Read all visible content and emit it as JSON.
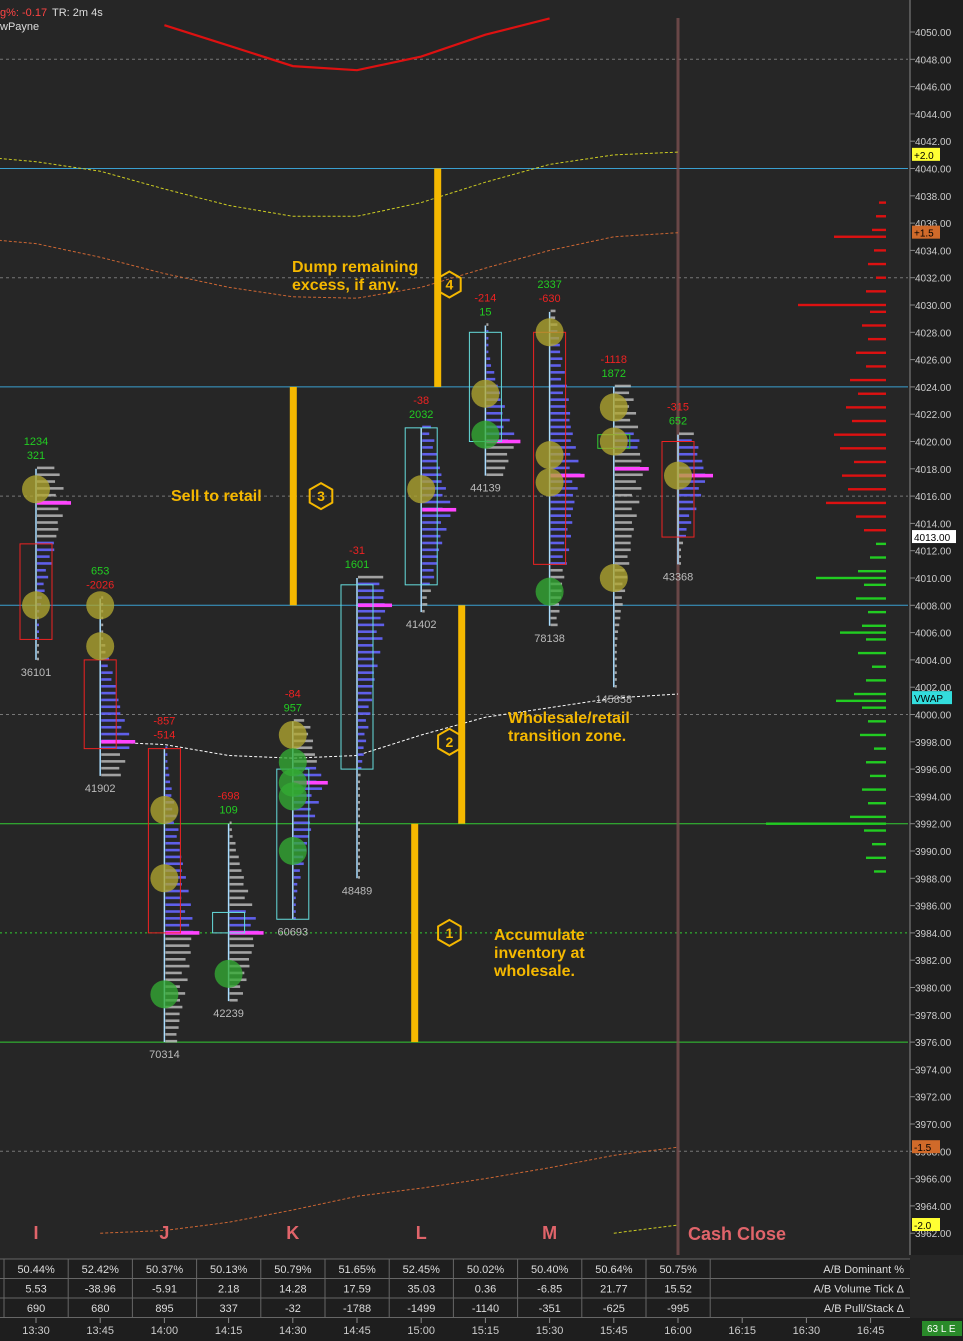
{
  "header": {
    "line1_a": "g%:",
    "line1_b": "-0.17",
    "line1_c": "TR: 2m 4s",
    "line2": "wPayne"
  },
  "colors": {
    "background": "#262626",
    "grid": "#555555",
    "price_axis_bg": "#1e1e1e",
    "annotation": "#f5b800",
    "buy_bar": "#6666ff",
    "sell_bar": "#cccccc",
    "poc": "#ff44ff",
    "delta_pos": "#22cc22",
    "delta_neg": "#ee2222",
    "vwap": "#ffffff",
    "blue_line": "#3a9fd0",
    "green_line": "#33cc33",
    "cash_close": "#e0646a"
  },
  "chart_data": {
    "type": "volume-profile",
    "y_axis": {
      "min": 3962,
      "max": 4051,
      "tick_step": 2,
      "side": "right"
    },
    "price_axis_labels": {
      "current": "4013.00",
      "vwap": "VWAP",
      "band_plus_2": "+2.0",
      "band_plus_1_5": "+1.5",
      "band_minus_1_5": "-1.5",
      "band_minus_2": "-2.0"
    },
    "x_axis": {
      "times": [
        "13:30",
        "13:45",
        "14:00",
        "14:15",
        "14:30",
        "14:45",
        "15:00",
        "15:15",
        "15:30",
        "15:45",
        "16:00",
        "16:15",
        "16:30",
        "16:45"
      ]
    },
    "period_letters": [
      {
        "letter": "I",
        "time": "13:30"
      },
      {
        "letter": "J",
        "time": "14:00"
      },
      {
        "letter": "K",
        "time": "14:30"
      },
      {
        "letter": "L",
        "time": "15:00"
      },
      {
        "letter": "M",
        "time": "15:30"
      }
    ],
    "cash_close": {
      "label": "Cash Close",
      "time": "16:00"
    },
    "horizontal_levels": [
      {
        "price": 4040.0,
        "color": "#3a9fd0",
        "style": "solid"
      },
      {
        "price": 4024.0,
        "color": "#3a9fd0",
        "style": "solid"
      },
      {
        "price": 4008.0,
        "color": "#3a9fd0",
        "style": "solid"
      },
      {
        "price": 3992.0,
        "color": "#33cc33",
        "style": "solid"
      },
      {
        "price": 3976.0,
        "color": "#33cc33",
        "style": "solid"
      },
      {
        "price": 3984.0,
        "color": "#33cc33",
        "style": "dotted"
      },
      {
        "price": 4048.0,
        "color": "#aaaaaa",
        "style": "dashed"
      },
      {
        "price": 4032.0,
        "color": "#aaaaaa",
        "style": "dashed"
      },
      {
        "price": 4016.0,
        "color": "#aaaaaa",
        "style": "dashed"
      },
      {
        "price": 4000.0,
        "color": "#aaaaaa",
        "style": "dashed"
      },
      {
        "price": 3968.0,
        "color": "#aaaaaa",
        "style": "dashed"
      }
    ],
    "profiles": [
      {
        "time": "13:30",
        "low": 4004.0,
        "high": 4018.0,
        "poc": 4015.5,
        "va_low": 4005.5,
        "va_high": 4012.5,
        "va_color": "#ee2222",
        "top_delta": "1234",
        "top_delta_color": "#22cc22",
        "second_delta": "321",
        "second_delta_color": "#22cc22",
        "volume": "36101",
        "circles": [
          {
            "price": 4016.5,
            "color": "yellow"
          },
          {
            "price": 4008.0,
            "color": "yellow"
          }
        ]
      },
      {
        "time": "13:45",
        "low": 3995.5,
        "high": 4008.5,
        "poc": 3998.0,
        "va_low": 3997.5,
        "va_high": 4004.0,
        "va_color": "#ee2222",
        "top_delta": "653",
        "top_delta_color": "#22cc22",
        "second_delta": "-2026",
        "second_delta_color": "#ee2222",
        "volume": "41902",
        "circles": [
          {
            "price": 4008.0,
            "color": "yellow"
          },
          {
            "price": 4005.0,
            "color": "yellow"
          }
        ]
      },
      {
        "time": "14:00",
        "low": 3976.0,
        "high": 3997.5,
        "poc": 3984.0,
        "va_low": 3984.0,
        "va_high": 3997.5,
        "va_color": "#ee2222",
        "top_delta": "-857",
        "top_delta_color": "#ee2222",
        "second_delta": "-514",
        "second_delta_color": "#ee2222",
        "volume": "70314",
        "circles": [
          {
            "price": 3993.0,
            "color": "yellow"
          },
          {
            "price": 3988.0,
            "color": "yellow"
          },
          {
            "price": 3979.5,
            "color": "green"
          }
        ]
      },
      {
        "time": "14:15",
        "low": 3979.0,
        "high": 3992.0,
        "poc": 3984.0,
        "va_low": 3984.0,
        "va_high": 3985.5,
        "va_color": "#66dddd",
        "top_delta": "-698",
        "top_delta_color": "#ee2222",
        "second_delta": "109",
        "second_delta_color": "#22cc22",
        "volume": "42239",
        "circles": [
          {
            "price": 3981.0,
            "color": "green"
          }
        ]
      },
      {
        "time": "14:30",
        "low": 3985.0,
        "high": 3999.5,
        "poc": 3995.0,
        "va_low": 3985.0,
        "va_high": 3996.0,
        "va_color": "#66dddd",
        "top_delta": "-84",
        "top_delta_color": "#ee2222",
        "second_delta": "957",
        "second_delta_color": "#22cc22",
        "volume": "60693",
        "circles": [
          {
            "price": 3998.5,
            "color": "yellow"
          },
          {
            "price": 3996.5,
            "color": "green"
          },
          {
            "price": 3995.0,
            "color": "green"
          },
          {
            "price": 3994.0,
            "color": "green"
          },
          {
            "price": 3990.0,
            "color": "green"
          }
        ]
      },
      {
        "time": "14:45",
        "low": 3988.0,
        "high": 4010.0,
        "poc": 4008.0,
        "va_low": 3996.0,
        "va_high": 4009.5,
        "va_color": "#66dddd",
        "top_delta": "-31",
        "top_delta_color": "#ee2222",
        "second_delta": "1601",
        "second_delta_color": "#22cc22",
        "volume": "48489",
        "circles": []
      },
      {
        "time": "15:00",
        "low": 4007.5,
        "high": 4021.0,
        "poc": 4015.0,
        "va_low": 4009.5,
        "va_high": 4021.0,
        "va_color": "#66dddd",
        "top_delta": "-38",
        "top_delta_color": "#ee2222",
        "second_delta": "2032",
        "second_delta_color": "#22cc22",
        "volume": "41402",
        "circles": [
          {
            "price": 4016.5,
            "color": "yellow"
          }
        ]
      },
      {
        "time": "15:15",
        "low": 4017.5,
        "high": 4028.5,
        "poc": 4020.0,
        "va_low": 4020.0,
        "va_high": 4028.0,
        "va_color": "#66dddd",
        "top_delta": "-214",
        "top_delta_color": "#ee2222",
        "second_delta": "15",
        "second_delta_color": "#22cc22",
        "volume": "44139",
        "circles": [
          {
            "price": 4023.5,
            "color": "yellow"
          },
          {
            "price": 4020.5,
            "color": "green"
          }
        ]
      },
      {
        "time": "15:30",
        "low": 4006.5,
        "high": 4029.5,
        "poc": 4017.5,
        "va_low": 4011.0,
        "va_high": 4028.0,
        "va_color": "#ee2222",
        "top_delta": "2337",
        "top_delta_color": "#22cc22",
        "second_delta": "-630",
        "second_delta_color": "#ee2222",
        "volume": "78138",
        "circles": [
          {
            "price": 4028.0,
            "color": "yellow"
          },
          {
            "price": 4019.0,
            "color": "yellow"
          },
          {
            "price": 4017.0,
            "color": "yellow"
          },
          {
            "price": 4009.0,
            "color": "green"
          }
        ]
      },
      {
        "time": "15:45",
        "low": 4002.0,
        "high": 4024.0,
        "poc": 4018.0,
        "va_low": 4019.5,
        "va_high": 4020.5,
        "va_color": "#33cc33",
        "top_delta": "-1118",
        "top_delta_color": "#ee2222",
        "second_delta": "1872",
        "second_delta_color": "#22cc22",
        "volume": "145858",
        "circles": [
          {
            "price": 4022.5,
            "color": "yellow"
          },
          {
            "price": 4020.0,
            "color": "yellow"
          },
          {
            "price": 4010.0,
            "color": "yellow"
          }
        ]
      },
      {
        "time": "16:00",
        "low": 4011.0,
        "high": 4020.5,
        "poc": 4017.5,
        "va_low": 4013.0,
        "va_high": 4020.0,
        "va_color": "#ee2222",
        "top_delta": "-315",
        "top_delta_color": "#ee2222",
        "second_delta": "652",
        "second_delta_color": "#22cc22",
        "volume": "43368",
        "circles": [
          {
            "price": 4017.5,
            "color": "yellow"
          }
        ]
      }
    ],
    "annotations": [
      {
        "number": "1",
        "text": [
          "Accumulate",
          "inventory at",
          "wholesale."
        ],
        "bar_time": "15:00",
        "bar_low": 3976,
        "bar_high": 3992,
        "badge_time": "15:15",
        "badge_price": 3984.0
      },
      {
        "number": "2",
        "text": [
          "Wholesale/retail",
          "transition zone."
        ],
        "bar_time": "15:00",
        "bar_low": 3992,
        "bar_high": 4008,
        "badge_time": "15:15",
        "badge_price": 3998.0
      },
      {
        "number": "3",
        "text": [
          "Sell to retail"
        ],
        "bar_time": "14:30",
        "bar_low": 4008,
        "bar_high": 4024,
        "badge_time": "14:45",
        "badge_price": 4016.0
      },
      {
        "number": "4",
        "text": [
          "Dump remaining",
          "excess, if any."
        ],
        "bar_time": "15:00",
        "bar_low": 4024,
        "bar_high": 4040,
        "badge_time": "15:15",
        "badge_price": 4031.5
      }
    ],
    "bands": {
      "vwap": [
        [
          13.75,
          3998.0
        ],
        [
          14.0,
          3997.8
        ],
        [
          14.25,
          3997.0
        ],
        [
          14.5,
          3996.8
        ],
        [
          14.75,
          3997.0
        ],
        [
          15.0,
          3998.5
        ],
        [
          15.25,
          3999.8
        ],
        [
          15.5,
          4000.5
        ],
        [
          15.75,
          4001.2
        ],
        [
          16.0,
          4001.5
        ]
      ],
      "upper_red": [
        [
          14.0,
          4050.5
        ],
        [
          14.25,
          4049.0
        ],
        [
          14.5,
          4047.5
        ],
        [
          14.75,
          4047.2
        ],
        [
          15.0,
          4048.2
        ],
        [
          15.25,
          4049.8
        ],
        [
          15.5,
          4051.0
        ]
      ],
      "upper_yellow": [
        [
          13.2,
          4041.0
        ],
        [
          13.5,
          4040.5
        ],
        [
          13.75,
          4039.8
        ],
        [
          14.0,
          4038.5
        ],
        [
          14.25,
          4037.3
        ],
        [
          14.5,
          4036.5
        ],
        [
          14.75,
          4036.5
        ],
        [
          15.0,
          4037.5
        ],
        [
          15.25,
          4039.0
        ],
        [
          15.5,
          4040.3
        ],
        [
          15.75,
          4041.0
        ],
        [
          16.0,
          4041.2
        ]
      ],
      "upper_orange": [
        [
          13.2,
          4035.0
        ],
        [
          13.5,
          4034.5
        ],
        [
          13.75,
          4033.5
        ],
        [
          14.0,
          4032.3
        ],
        [
          14.25,
          4031.3
        ],
        [
          14.5,
          4030.6
        ],
        [
          14.75,
          4030.5
        ],
        [
          15.0,
          4031.3
        ],
        [
          15.25,
          4032.7
        ],
        [
          15.5,
          4034.0
        ],
        [
          15.75,
          4035.0
        ],
        [
          16.0,
          4035.3
        ]
      ],
      "lower_orange": [
        [
          13.75,
          3962.0
        ],
        [
          14.0,
          3962.2
        ],
        [
          14.25,
          3962.8
        ],
        [
          14.5,
          3963.7
        ],
        [
          14.75,
          3964.7
        ],
        [
          15.0,
          3965.3
        ],
        [
          15.25,
          3966.0
        ],
        [
          15.5,
          3966.8
        ],
        [
          15.75,
          3967.7
        ],
        [
          16.0,
          3968.3
        ]
      ],
      "lower_yellow": [
        [
          15.75,
          3962.0
        ],
        [
          16.0,
          3962.6
        ]
      ]
    },
    "session_profile": {
      "sell": [
        [
          4037.5,
          7
        ],
        [
          4036.5,
          10
        ],
        [
          4035.5,
          14
        ],
        [
          4035.0,
          52
        ],
        [
          4034.0,
          12
        ],
        [
          4033.0,
          18
        ],
        [
          4032.0,
          10
        ],
        [
          4031.0,
          20
        ],
        [
          4030.0,
          88
        ],
        [
          4029.5,
          16
        ],
        [
          4028.5,
          24
        ],
        [
          4027.5,
          18
        ],
        [
          4026.5,
          30
        ],
        [
          4025.5,
          20
        ],
        [
          4024.5,
          36
        ],
        [
          4023.5,
          28
        ],
        [
          4022.5,
          40
        ],
        [
          4021.5,
          34
        ],
        [
          4020.5,
          52
        ],
        [
          4019.5,
          46
        ],
        [
          4018.5,
          32
        ],
        [
          4017.5,
          44
        ],
        [
          4016.5,
          38
        ],
        [
          4015.5,
          60
        ],
        [
          4014.5,
          30
        ],
        [
          4013.5,
          22
        ]
      ],
      "buy": [
        [
          4012.5,
          10
        ],
        [
          4011.5,
          16
        ],
        [
          4010.5,
          28
        ],
        [
          4010.0,
          70
        ],
        [
          4009.5,
          22
        ],
        [
          4008.5,
          30
        ],
        [
          4007.5,
          18
        ],
        [
          4006.5,
          24
        ],
        [
          4006.0,
          46
        ],
        [
          4005.5,
          20
        ],
        [
          4004.5,
          28
        ],
        [
          4003.5,
          14
        ],
        [
          4002.5,
          20
        ],
        [
          4001.5,
          32
        ],
        [
          4001.0,
          50
        ],
        [
          4000.5,
          24
        ],
        [
          3999.5,
          18
        ],
        [
          3998.5,
          26
        ],
        [
          3997.5,
          12
        ],
        [
          3996.5,
          20
        ],
        [
          3995.5,
          16
        ],
        [
          3994.5,
          24
        ],
        [
          3993.5,
          18
        ],
        [
          3992.5,
          36
        ],
        [
          3992.0,
          120
        ],
        [
          3991.5,
          22
        ],
        [
          3990.5,
          14
        ],
        [
          3989.5,
          20
        ],
        [
          3988.5,
          12
        ]
      ]
    }
  },
  "stats_table": {
    "rows": [
      {
        "label": "A/B Dominant %",
        "values": [
          "50.44%",
          "52.42%",
          "50.37%",
          "50.13%",
          "50.79%",
          "51.65%",
          "52.45%",
          "50.02%",
          "50.40%",
          "50.64%",
          "50.75%"
        ]
      },
      {
        "label": "A/B Volume Tick Δ",
        "values": [
          "5.53",
          "-38.96",
          "-5.91",
          "2.18",
          "14.28",
          "17.59",
          "35.03",
          "0.36",
          "-6.85",
          "21.77",
          "15.52"
        ]
      },
      {
        "label": "A/B Pull/Stack Δ",
        "values": [
          "690",
          "680",
          "895",
          "337",
          "-32",
          "-1788",
          "-1499",
          "-1140",
          "-351",
          "-625",
          "-995"
        ]
      }
    ]
  },
  "status_badge": "63 L E"
}
